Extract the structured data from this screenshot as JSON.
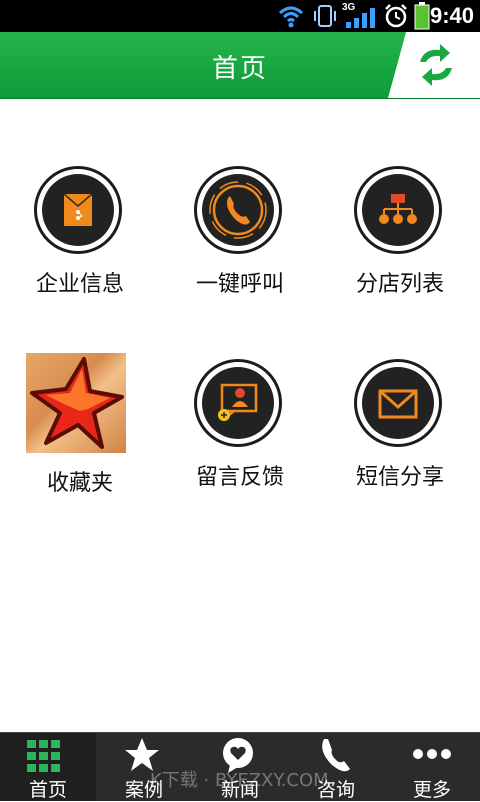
{
  "status_bar": {
    "time": "9:40",
    "network": "3G",
    "icons": [
      "wifi-icon",
      "vibrate-icon",
      "signal-icon",
      "alarm-icon",
      "battery-icon"
    ]
  },
  "header": {
    "title": "首页",
    "refresh_icon": "refresh-icon"
  },
  "grid": [
    {
      "label": "企业信息",
      "icon": "envelope-file-icon"
    },
    {
      "label": "一键呼叫",
      "icon": "phone-icon"
    },
    {
      "label": "分店列表",
      "icon": "org-chart-icon"
    },
    {
      "label": "收藏夹",
      "icon": "star-icon"
    },
    {
      "label": "留言反馈",
      "icon": "feedback-icon"
    },
    {
      "label": "短信分享",
      "icon": "mail-icon"
    }
  ],
  "bottom_nav": [
    {
      "label": "首页",
      "icon": "grid-icon",
      "active": true
    },
    {
      "label": "案例",
      "icon": "star-icon"
    },
    {
      "label": "新闻",
      "icon": "heart-bubble-icon"
    },
    {
      "label": "咨询",
      "icon": "phone-icon"
    },
    {
      "label": "更多",
      "icon": "more-icon"
    }
  ],
  "watermark": "K下载 · BYEZXY.COM",
  "colors": {
    "header_green": "#1aa843",
    "accent_orange": "#f08a1c",
    "nav_active_green": "#2db55d",
    "nav_bg": "#2b2b2b"
  }
}
